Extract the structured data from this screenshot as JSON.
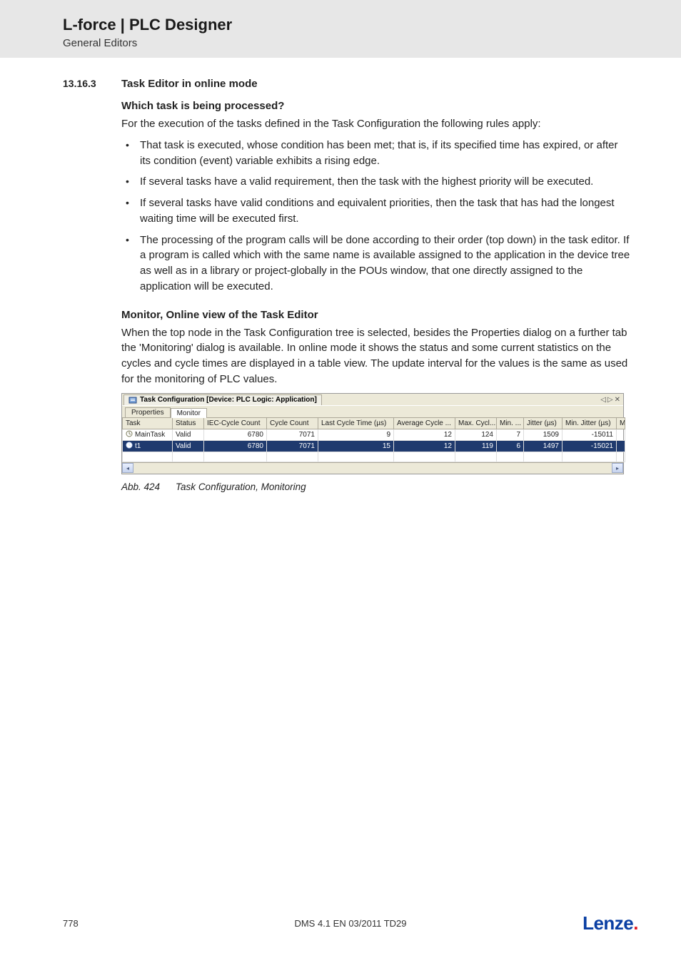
{
  "header": {
    "title": "L-force | PLC Designer",
    "subtitle": "General Editors"
  },
  "section": {
    "number": "13.16.3",
    "title": "Task Editor in online mode",
    "question": "Which task is being processed?",
    "intro": "For the execution of the tasks defined in the Task Configuration the following rules apply:",
    "bullets": [
      "That task is executed, whose condition has been met; that is, if its specified time has expired, or after its condition (event) variable exhibits a rising edge.",
      "If several tasks have a valid requirement, then the task with the highest priority will be executed.",
      "If several tasks have valid conditions and equivalent priorities, then the task that has had the longest waiting time will be executed first.",
      "The processing of the program calls will be done according to their order (top down) in the task editor. If a program is called which with the same name is available assigned to the application in the device tree as well as in a library or project-globally in the POUs window, that one directly assigned to the application will be executed."
    ],
    "subhead": "Monitor, Online view of the Task Editor",
    "para2": "When the top node in the Task Configuration tree is selected, besides the Properties dialog on a further tab the 'Monitoring' dialog is available. In online mode it shows the status and some current statistics on the cycles and cycle times are displayed in a table view. The update interval for the values is the same as used for the monitoring of PLC values."
  },
  "shot": {
    "topTab": "Task Configuration [Device: PLC Logic: Application]",
    "controls": {
      "left": "◁",
      "right": "▷",
      "close": "✕"
    },
    "subTabs": {
      "properties": "Properties",
      "monitor": "Monitor"
    },
    "columns": [
      "Task",
      "Status",
      "IEC-Cycle Count",
      "Cycle Count",
      "Last Cycle Time (µs)",
      "Average Cycle ...",
      "Max. Cycl...",
      "Min. ...",
      "Jitter (µs)",
      "Min. Jitter (µs)",
      "M"
    ],
    "rows": [
      {
        "task": "MainTask",
        "status": "Valid",
        "iec": "6780",
        "cycle": "7071",
        "last": "9",
        "avg": "12",
        "max": "124",
        "min": "7",
        "jit": "1509",
        "mjit": "-15011"
      },
      {
        "task": "t1",
        "status": "Valid",
        "iec": "6780",
        "cycle": "7071",
        "last": "15",
        "avg": "12",
        "max": "119",
        "min": "6",
        "jit": "1497",
        "mjit": "-15021"
      }
    ]
  },
  "caption": {
    "label": "Abb. 424",
    "text": "Task Configuration, Monitoring"
  },
  "footer": {
    "page": "778",
    "mid": "DMS 4.1 EN 03/2011 TD29",
    "brand": "Lenze"
  }
}
